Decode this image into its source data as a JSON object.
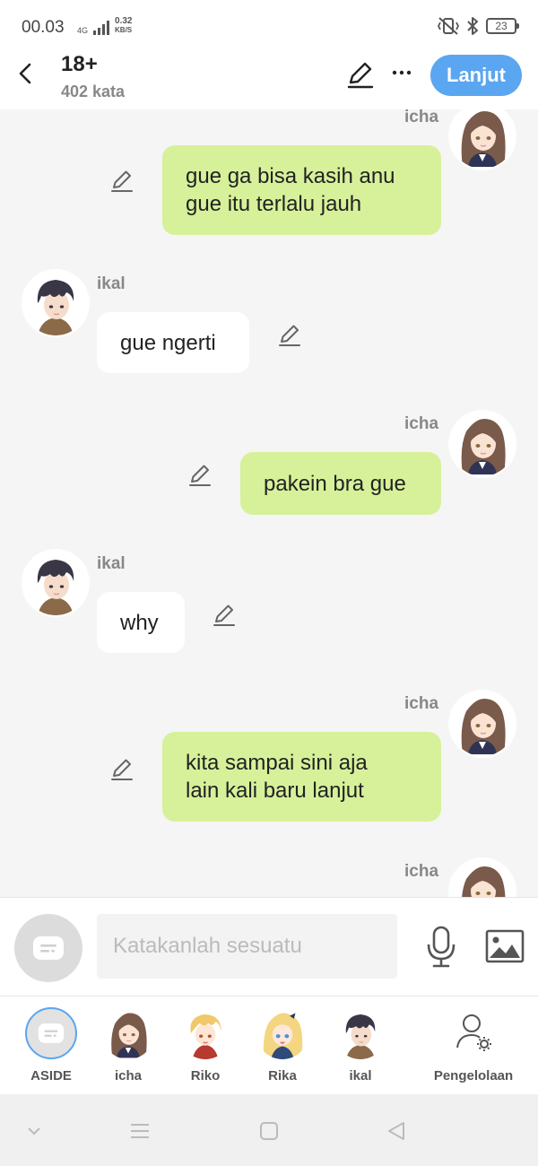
{
  "status_bar": {
    "time": "00.03",
    "network_type": "4G",
    "speed_value": "0.32",
    "speed_unit": "KB/S",
    "battery": "23",
    "icons": [
      "vibrate-icon",
      "bluetooth-icon",
      "battery-icon"
    ]
  },
  "header": {
    "title": "18+",
    "subtitle": "402 kata",
    "primary_button": "Lanjut",
    "icons": [
      "back-icon",
      "pencil-icon",
      "more-icon"
    ],
    "accent_color": "#5aa6f0"
  },
  "messages": [
    {
      "sender": "icha",
      "side": "right",
      "lines": [
        "gue ga bisa kasih anu",
        "gue itu terlalu jauh"
      ]
    },
    {
      "sender": "ikal",
      "side": "left",
      "lines": [
        "gue ngerti"
      ]
    },
    {
      "sender": "icha",
      "side": "right",
      "lines": [
        "pakein bra gue"
      ]
    },
    {
      "sender": "ikal",
      "side": "left",
      "lines": [
        "why"
      ]
    },
    {
      "sender": "icha",
      "side": "right",
      "lines": [
        "kita sampai sini aja",
        "lain kali baru lanjut"
      ]
    },
    {
      "sender": "icha",
      "side": "right",
      "lines": []
    }
  ],
  "bubble_colors": {
    "right": "#d6f19a",
    "left": "#ffffff"
  },
  "composer": {
    "placeholder": "Katakanlah sesuatu",
    "icons": [
      "aside-icon",
      "microphone-icon",
      "image-icon"
    ]
  },
  "characters": [
    {
      "label": "ASIDE",
      "icon": "aside-icon",
      "selected": true
    },
    {
      "label": "icha",
      "icon": "icha-avatar"
    },
    {
      "label": "Riko",
      "icon": "riko-avatar"
    },
    {
      "label": "Rika",
      "icon": "rika-avatar"
    },
    {
      "label": "ikal",
      "icon": "ikal-avatar"
    },
    {
      "label": "Pengelolaan",
      "icon": "manage-user-icon"
    }
  ],
  "nav": {
    "icons": [
      "chevron-down-icon",
      "menu-icon",
      "home-square-icon",
      "back-triangle-icon"
    ]
  }
}
